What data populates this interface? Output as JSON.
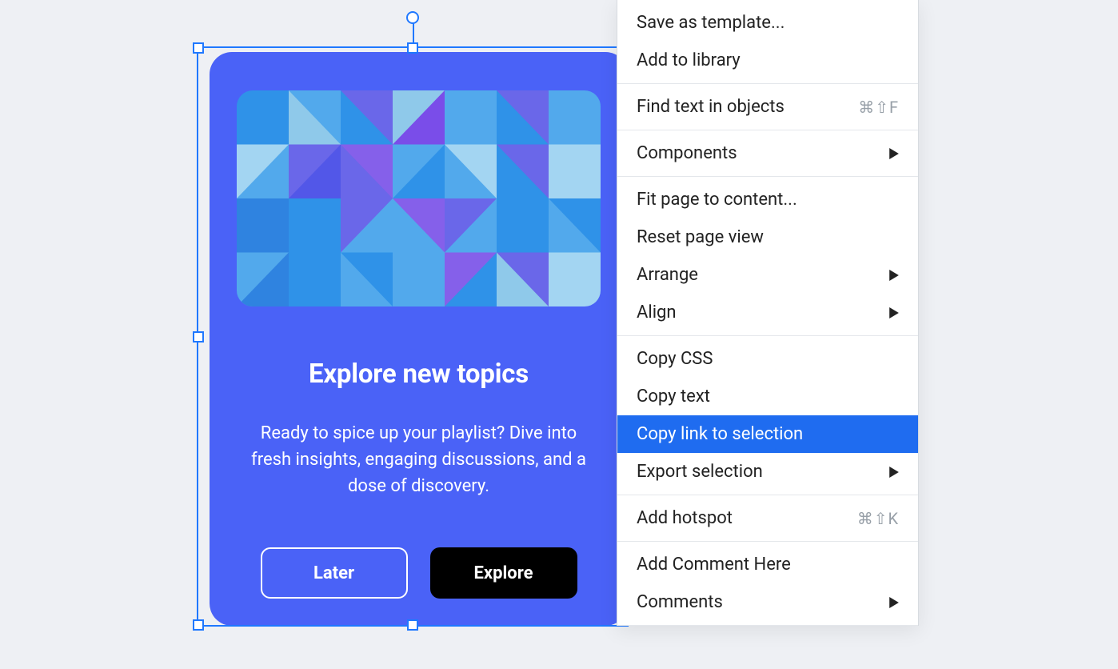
{
  "card": {
    "heading": "Explore new topics",
    "description": "Ready to spice up your playlist? Dive into fresh insights, engaging discussions, and a dose of discovery.",
    "buttons": {
      "later": "Later",
      "explore": "Explore"
    }
  },
  "menu": {
    "sections": [
      [
        {
          "id": "save-as-template",
          "label": "Save as template..."
        },
        {
          "id": "add-to-library",
          "label": "Add to library"
        }
      ],
      [
        {
          "id": "find-text",
          "label": "Find text in objects",
          "shortcut": "⌘⇧F"
        }
      ],
      [
        {
          "id": "components",
          "label": "Components",
          "submenu": true
        }
      ],
      [
        {
          "id": "fit-page",
          "label": "Fit page to content..."
        },
        {
          "id": "reset-page-view",
          "label": "Reset page view"
        },
        {
          "id": "arrange",
          "label": "Arrange",
          "submenu": true
        },
        {
          "id": "align",
          "label": "Align",
          "submenu": true
        }
      ],
      [
        {
          "id": "copy-css",
          "label": "Copy CSS"
        },
        {
          "id": "copy-text",
          "label": "Copy text"
        },
        {
          "id": "copy-link",
          "label": "Copy link to selection",
          "highlight": true
        },
        {
          "id": "export-selection",
          "label": "Export selection",
          "submenu": true
        }
      ],
      [
        {
          "id": "add-hotspot",
          "label": "Add hotspot",
          "shortcut": "⌘⇧K"
        }
      ],
      [
        {
          "id": "add-comment-here",
          "label": "Add Comment Here"
        },
        {
          "id": "comments",
          "label": "Comments",
          "submenu": true
        }
      ]
    ]
  }
}
